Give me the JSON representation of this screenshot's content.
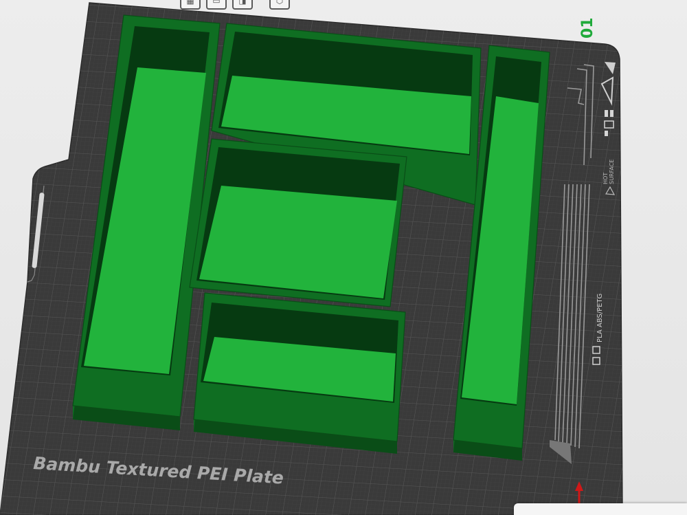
{
  "plate": {
    "label": "Bambu Textured PEI Plate",
    "plate_number": "01",
    "filament_note": "PLA ABS/PETG",
    "hot_surface_line1": "HOT",
    "hot_surface_line2": "SURFACE"
  },
  "colors": {
    "bed": "#3b3b3b",
    "grid_line": "#555555",
    "part_wall": "#0f6e22",
    "part_wall_dark": "#0a4d17",
    "part_floor": "#22b33c",
    "part_inner_shadow": "#063a11",
    "plate_number": "#1faa3a",
    "axis_arrow": "#d01818"
  },
  "toolbar": {
    "buttons": [
      {
        "name": "arrange-button",
        "icon": "arrange-icon"
      },
      {
        "name": "layout-button",
        "icon": "layout-icon"
      },
      {
        "name": "orient-button",
        "icon": "orient-icon"
      },
      {
        "name": "settings-button",
        "icon": "gear-icon"
      }
    ]
  },
  "parts": [
    {
      "name": "bin-tall-left"
    },
    {
      "name": "bin-wide-top"
    },
    {
      "name": "bin-tall-right"
    },
    {
      "name": "bin-medium-center"
    },
    {
      "name": "bin-small-bottom"
    }
  ]
}
